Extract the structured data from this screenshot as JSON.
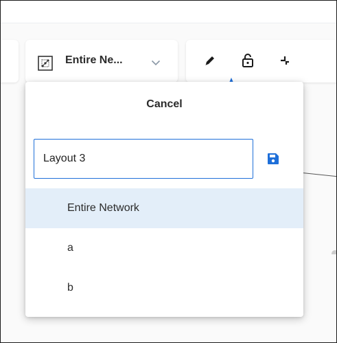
{
  "toolbar": {
    "layout_selector_label": "Entire Ne...",
    "layout_icon": "network-layout-icon",
    "chevron_icon": "chevron-down-icon",
    "tools": [
      {
        "icon": "pencil-icon"
      },
      {
        "icon": "lock-open-icon"
      },
      {
        "icon": "compress-icon"
      }
    ],
    "accent_color": "#1e6fd9"
  },
  "layout_menu": {
    "cancel_label": "Cancel",
    "name_input_value": "Layout 3",
    "save_icon": "save-icon",
    "items": [
      {
        "label": "Entire Network",
        "selected": true
      },
      {
        "label": "a",
        "selected": false
      },
      {
        "label": "b",
        "selected": false
      }
    ],
    "selected_color": "#e3eef9"
  }
}
